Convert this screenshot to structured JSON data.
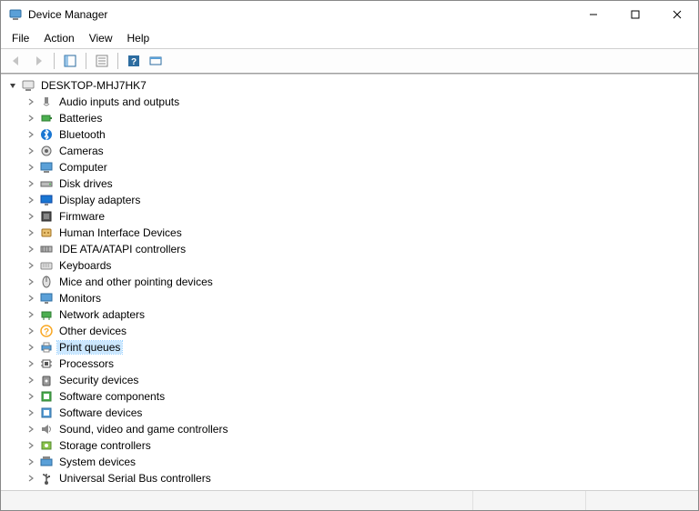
{
  "window": {
    "title": "Device Manager"
  },
  "menu": {
    "file": "File",
    "action": "Action",
    "view": "View",
    "help": "Help"
  },
  "tree": {
    "root": "DESKTOP-MHJ7HK7",
    "items": [
      {
        "icon": "audio",
        "label": "Audio inputs and outputs"
      },
      {
        "icon": "battery",
        "label": "Batteries"
      },
      {
        "icon": "bluetooth",
        "label": "Bluetooth"
      },
      {
        "icon": "camera",
        "label": "Cameras"
      },
      {
        "icon": "computer",
        "label": "Computer"
      },
      {
        "icon": "disk",
        "label": "Disk drives"
      },
      {
        "icon": "display",
        "label": "Display adapters"
      },
      {
        "icon": "firmware",
        "label": "Firmware"
      },
      {
        "icon": "hid",
        "label": "Human Interface Devices"
      },
      {
        "icon": "ide",
        "label": "IDE ATA/ATAPI controllers"
      },
      {
        "icon": "keyboard",
        "label": "Keyboards"
      },
      {
        "icon": "mouse",
        "label": "Mice and other pointing devices"
      },
      {
        "icon": "monitor",
        "label": "Monitors"
      },
      {
        "icon": "network",
        "label": "Network adapters"
      },
      {
        "icon": "other",
        "label": "Other devices"
      },
      {
        "icon": "printer",
        "label": "Print queues",
        "selected": true
      },
      {
        "icon": "processor",
        "label": "Processors"
      },
      {
        "icon": "security",
        "label": "Security devices"
      },
      {
        "icon": "software",
        "label": "Software components"
      },
      {
        "icon": "softdev",
        "label": "Software devices"
      },
      {
        "icon": "sound",
        "label": "Sound, video and game controllers"
      },
      {
        "icon": "storage",
        "label": "Storage controllers"
      },
      {
        "icon": "system",
        "label": "System devices"
      },
      {
        "icon": "usb",
        "label": "Universal Serial Bus controllers"
      }
    ]
  }
}
